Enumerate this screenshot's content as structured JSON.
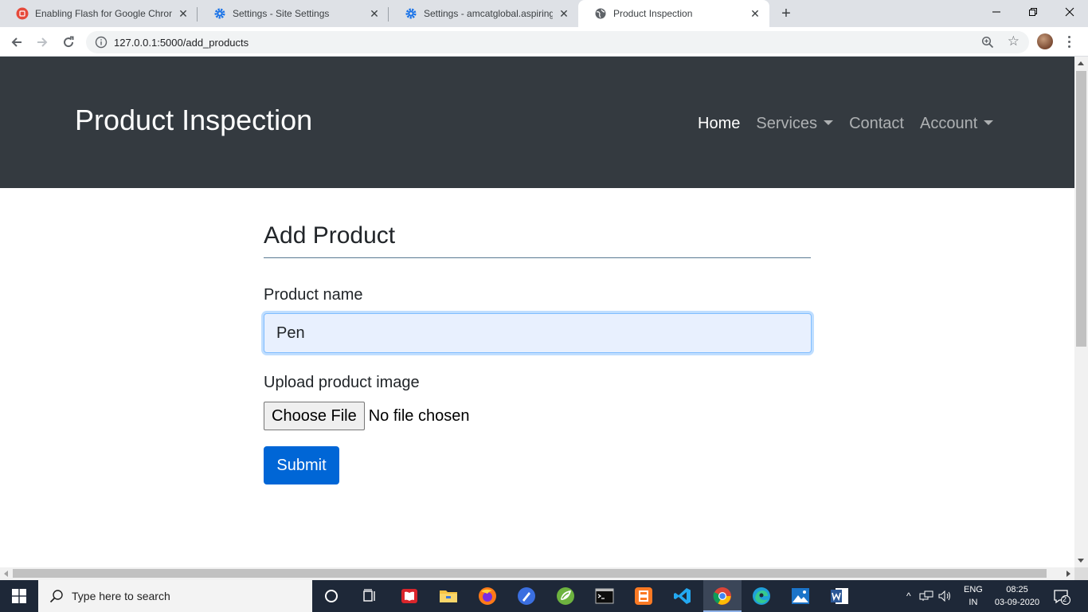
{
  "browser": {
    "tabs": [
      {
        "title": "Enabling Flash for Google Chrom",
        "icon": "flash-icon",
        "active": false
      },
      {
        "title": "Settings - Site Settings",
        "icon": "gear-icon",
        "active": false
      },
      {
        "title": "Settings - amcatglobal.aspiringm",
        "icon": "gear-icon",
        "active": false
      },
      {
        "title": "Product Inspection",
        "icon": "globe-icon",
        "active": true
      }
    ],
    "url": "127.0.0.1:5000/add_products"
  },
  "navbar": {
    "brand": "Product Inspection",
    "links": [
      {
        "label": "Home",
        "active": true,
        "dropdown": false
      },
      {
        "label": "Services",
        "active": false,
        "dropdown": true
      },
      {
        "label": "Contact",
        "active": false,
        "dropdown": false
      },
      {
        "label": "Account",
        "active": false,
        "dropdown": true
      }
    ],
    "background": "#343a40"
  },
  "form": {
    "heading": "Add Product",
    "name_label": "Product name",
    "name_value": "Pen",
    "upload_label": "Upload product image",
    "file_button": "Choose File",
    "file_status": "No file chosen",
    "submit_label": "Submit",
    "accent": "#0066d6"
  },
  "taskbar": {
    "search_placeholder": "Type here to search",
    "language": "ENG",
    "region": "IN",
    "time": "08:25",
    "date": "03-09-2020",
    "notification_count": "2",
    "apps": [
      "task-view-icon",
      "timeline-icon",
      "reader-icon",
      "file-explorer-icon",
      "firefox-icon",
      "pen-app-icon",
      "spring-icon",
      "terminal-icon",
      "xampp-icon",
      "vscode-icon",
      "chrome-icon",
      "edge-icon",
      "photos-icon",
      "word-icon"
    ]
  }
}
